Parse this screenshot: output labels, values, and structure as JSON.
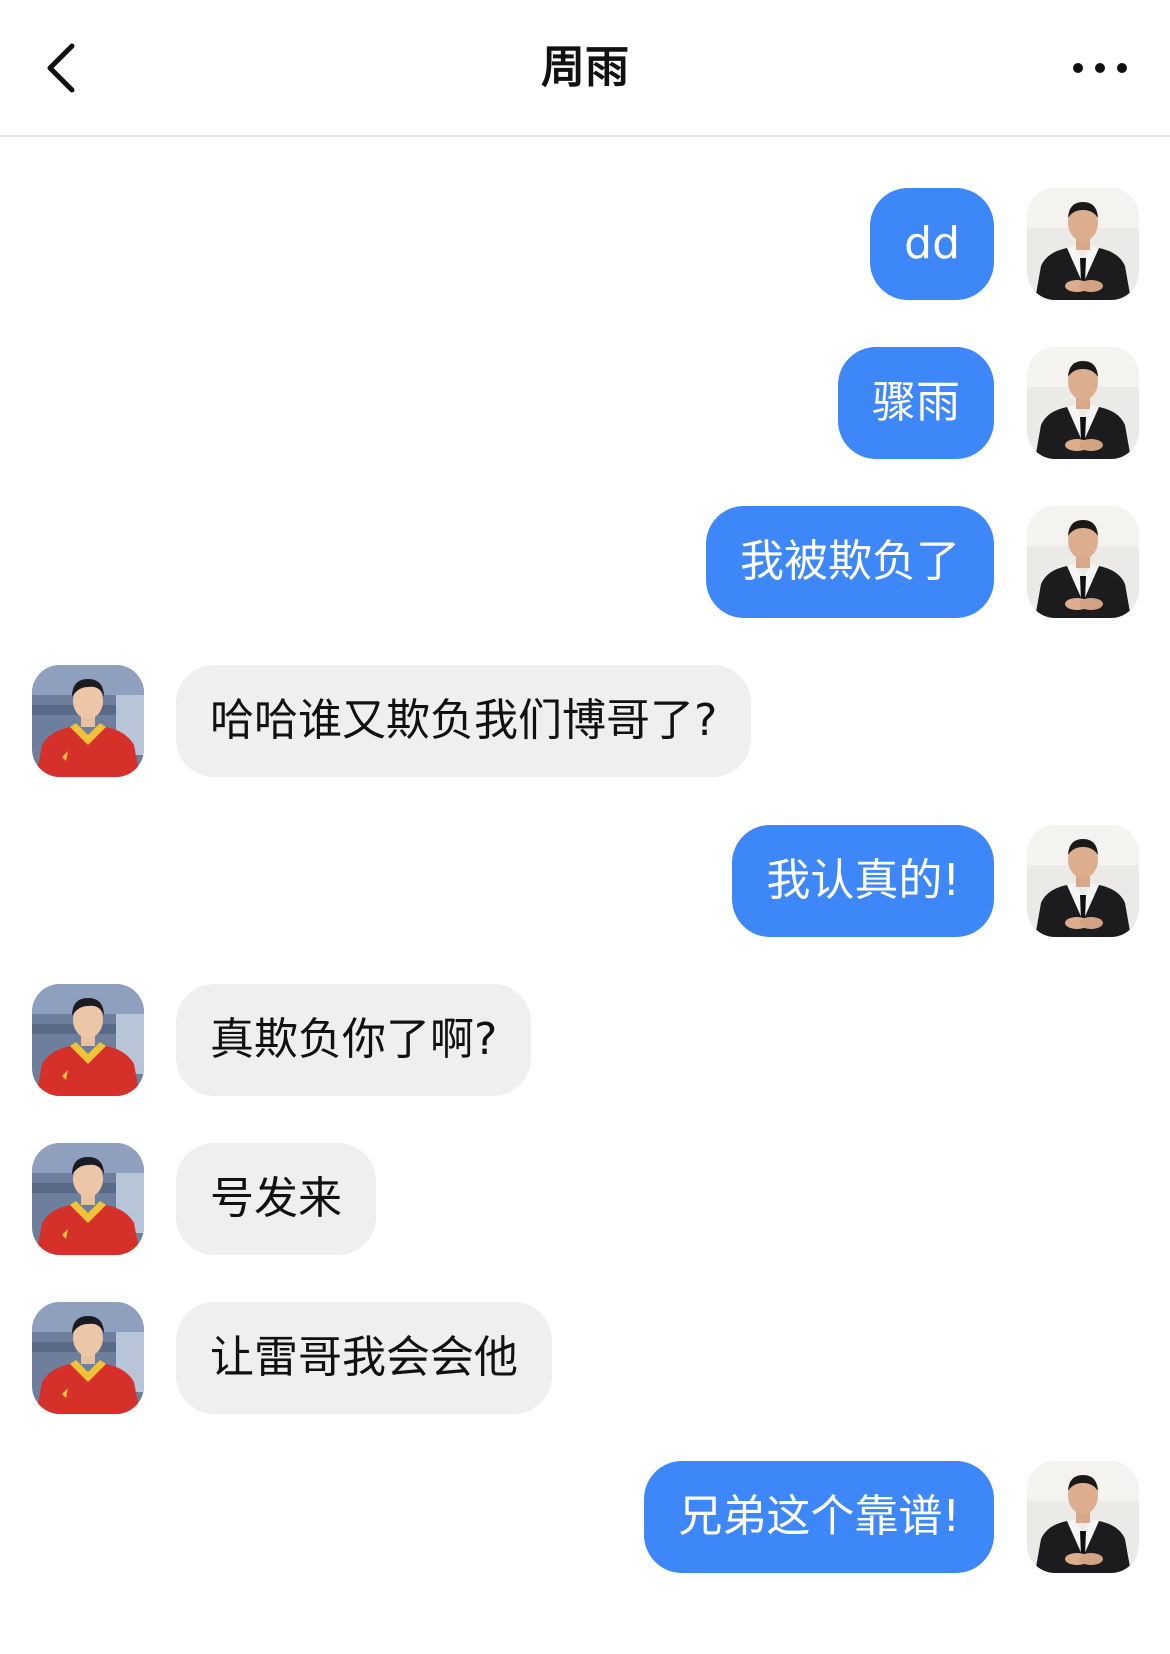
{
  "header": {
    "title": "周雨",
    "back_icon": "chevron-left-icon",
    "more_icon": "more-horizontal-icon"
  },
  "colors": {
    "sent_bubble": "#3e87f8",
    "received_bubble": "#efefef",
    "divider": "#e4e4e4"
  },
  "messages": [
    {
      "sender": "me",
      "text": "dd"
    },
    {
      "sender": "me",
      "text": "骤雨"
    },
    {
      "sender": "me",
      "text": "我被欺负了"
    },
    {
      "sender": "other",
      "text": "哈哈谁又欺负我们博哥了?"
    },
    {
      "sender": "me",
      "text": "我认真的!"
    },
    {
      "sender": "other",
      "text": "真欺负你了啊?"
    },
    {
      "sender": "other",
      "text": "号发来"
    },
    {
      "sender": "other",
      "text": "让雷哥我会会他"
    },
    {
      "sender": "me",
      "text": "兄弟这个靠谱!"
    }
  ]
}
